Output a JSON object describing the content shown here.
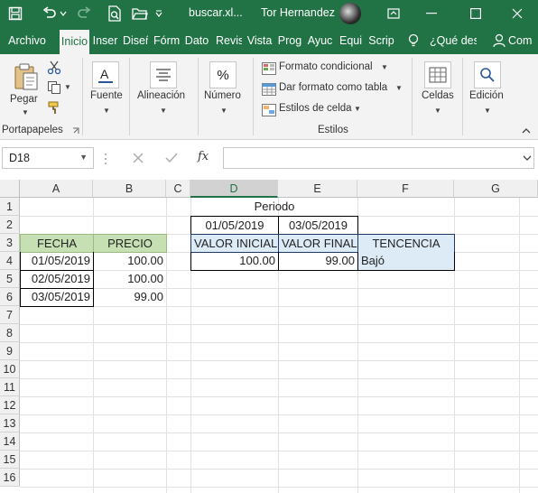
{
  "window": {
    "filename": "buscar.xl...",
    "user": "Tor Hernandez"
  },
  "tabs": [
    "Archivo",
    "Inicio",
    "Inser",
    "Diseñ",
    "Fórm",
    "Dato",
    "Revis",
    "Vista",
    "Prog",
    "Ayuc",
    "Equi",
    "Scrip",
    "¿Qué des",
    "Com"
  ],
  "ribbon": {
    "paste": "Pegar",
    "clipboard": "Portapapeles",
    "font": "Fuente",
    "alignment": "Alineación",
    "number": "Número",
    "cond_format": "Formato condicional",
    "table_format": "Dar formato como tabla",
    "cell_styles": "Estilos de celda",
    "styles": "Estilos",
    "cells": "Celdas",
    "editing": "Edición",
    "percent_glyph": "%",
    "font_glyph": "A"
  },
  "formula_bar": {
    "name_box": "D18",
    "fx": "fx",
    "value": ""
  },
  "columns": [
    "A",
    "B",
    "C",
    "D",
    "E",
    "F",
    "G"
  ],
  "rows": [
    "1",
    "2",
    "3",
    "4",
    "5",
    "6",
    "7",
    "8",
    "9",
    "10",
    "11",
    "12",
    "13",
    "14",
    "15",
    "16"
  ],
  "cells": {
    "d1": "Periodo",
    "d2": "01/05/2019",
    "e2": "03/05/2019",
    "a3": "FECHA",
    "b3": "PRECIO",
    "d3": "VALOR INICIAL",
    "e3": "VALOR FINAL",
    "f3": "TENCENCIA",
    "a4": "01/05/2019",
    "b4": "100.00",
    "d4": "100.00",
    "e4": "99.00",
    "f4": "Bajó",
    "a5": "02/05/2019",
    "b5": "100.00",
    "a6": "03/05/2019",
    "b6": "99.00"
  },
  "colors": {
    "brand": "#217346",
    "header_green": "#c6e0b4",
    "header_blue": "#ddebf7"
  }
}
